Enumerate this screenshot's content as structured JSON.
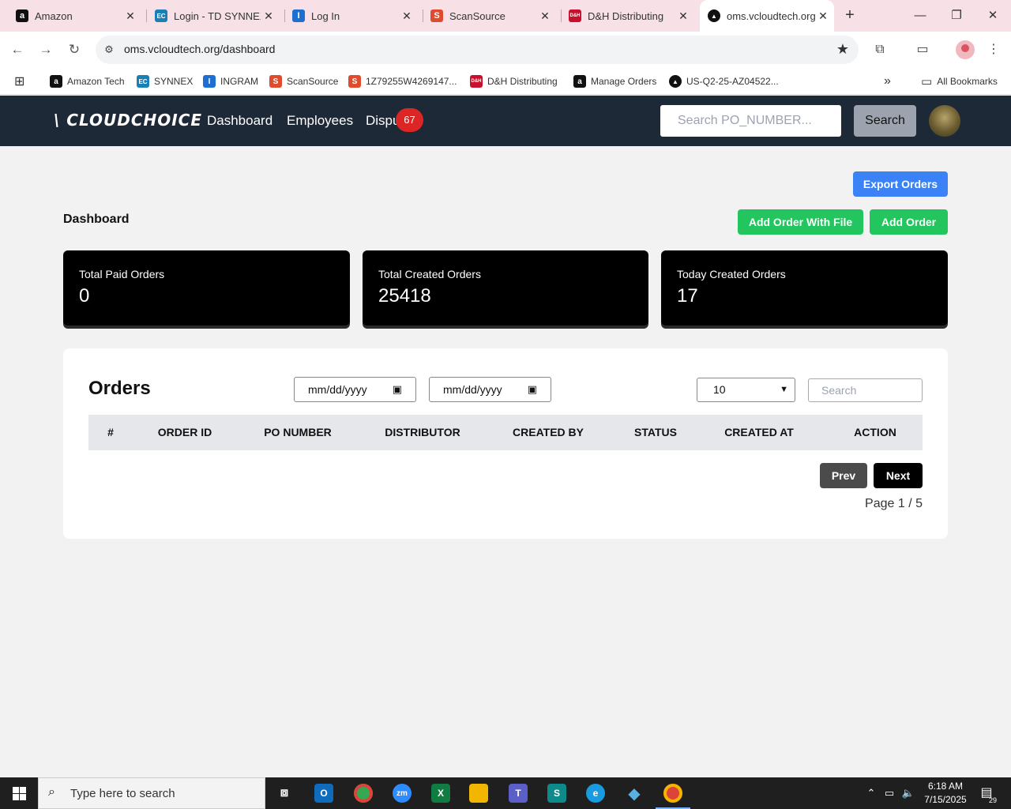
{
  "browser": {
    "tabs": [
      {
        "label": "Amazon",
        "icon": "amazon-icon",
        "fav_text": "a",
        "fav_color": "#111111"
      },
      {
        "label": "Login - TD SYNNEX",
        "icon": "tdsynnex-icon",
        "fav_text": "EC",
        "fav_color": "#1a7fb5"
      },
      {
        "label": "Log In",
        "icon": "ingram-icon",
        "fav_text": "I",
        "fav_color": "#1f6fd1"
      },
      {
        "label": "ScanSource",
        "icon": "scansource-icon",
        "fav_text": "S",
        "fav_color": "#e04a2d"
      },
      {
        "label": "D&H Distributing",
        "icon": "dh-icon",
        "fav_text": "D&H",
        "fav_color": "#c8102e"
      },
      {
        "label": "oms.vcloudtech.org",
        "icon": "vcloud-icon",
        "fav_text": "▲",
        "fav_color": "#111111"
      }
    ],
    "new_tab": "+",
    "window_controls": {
      "minimize": "—",
      "restore": "❐",
      "close": "✕"
    },
    "url": "oms.vcloudtech.org/dashboard",
    "bookmarks": [
      {
        "label": "Amazon Tech",
        "fav_text": "a",
        "fav_color": "#111111"
      },
      {
        "label": "SYNNEX",
        "fav_text": "EC",
        "fav_color": "#1a7fb5"
      },
      {
        "label": "INGRAM",
        "fav_text": "I",
        "fav_color": "#1f6fd1"
      },
      {
        "label": "ScanSource",
        "fav_text": "S",
        "fav_color": "#e04a2d"
      },
      {
        "label": "1Z79255W4269147...",
        "fav_text": "S",
        "fav_color": "#e04a2d"
      },
      {
        "label": "D&H Distributing",
        "fav_text": "D&H",
        "fav_color": "#c8102e"
      },
      {
        "label": "Manage Orders",
        "fav_text": "a",
        "fav_color": "#111111"
      },
      {
        "label": "US-Q2-25-AZ04522...",
        "fav_text": "▲",
        "fav_color": "#111111"
      }
    ],
    "more_bookmarks": "»",
    "all_bookmarks": "All Bookmarks"
  },
  "app": {
    "logo": "\\ CLOUDCHOICE",
    "nav": {
      "dashboard": "Dashboard",
      "employees": "Employees",
      "disputes": "Dispu"
    },
    "disputes_badge": "67",
    "search_placeholder": "Search PO_NUMBER...",
    "search_button": "Search"
  },
  "dashboard": {
    "title": "Dashboard",
    "export_button": "Export Orders",
    "add_with_file_button": "Add Order With File",
    "add_order_button": "Add Order",
    "stats": [
      {
        "label": "Total Paid Orders",
        "value": "0"
      },
      {
        "label": "Total Created Orders",
        "value": "25418"
      },
      {
        "label": "Today Created Orders",
        "value": "17"
      }
    ]
  },
  "orders": {
    "title": "Orders",
    "date_from": "mm/dd/yyyy",
    "date_to": "mm/dd/yyyy",
    "page_size": "10",
    "search_placeholder": "Search",
    "columns": [
      "#",
      "ORDER ID",
      "PO NUMBER",
      "DISTRIBUTOR",
      "CREATED BY",
      "STATUS",
      "CREATED AT",
      "ACTION"
    ],
    "rows": [],
    "prev": "Prev",
    "next": "Next",
    "page_info": "Page 1 / 5"
  },
  "taskbar": {
    "search_placeholder": "Type here to search",
    "time": "6:18 AM",
    "date": "7/15/2025",
    "notification_count": "29",
    "apps": [
      {
        "name": "task-view-icon",
        "glyph": "▤",
        "color": "#1f1f1f"
      },
      {
        "name": "outlook-icon",
        "glyph": "O",
        "color": "#0f6cbd"
      },
      {
        "name": "chrome-icon",
        "glyph": "●",
        "color": "#34a853"
      },
      {
        "name": "zoom-icon",
        "glyph": "zm",
        "color": "#2d8cff"
      },
      {
        "name": "excel-icon",
        "glyph": "X",
        "color": "#107c41"
      },
      {
        "name": "file-explorer-icon",
        "glyph": "▬",
        "color": "#f2b600"
      },
      {
        "name": "teams-icon",
        "glyph": "T",
        "color": "#5b5fc7"
      },
      {
        "name": "sway-icon",
        "glyph": "S",
        "color": "#0f8a8a"
      },
      {
        "name": "edge-icon",
        "glyph": "e",
        "color": "#1a9be0"
      },
      {
        "name": "app-diamond-icon",
        "glyph": "◆",
        "color": "#3a6ea5"
      },
      {
        "name": "chrome-profile-icon",
        "glyph": "●",
        "color": "#db4437"
      }
    ]
  }
}
